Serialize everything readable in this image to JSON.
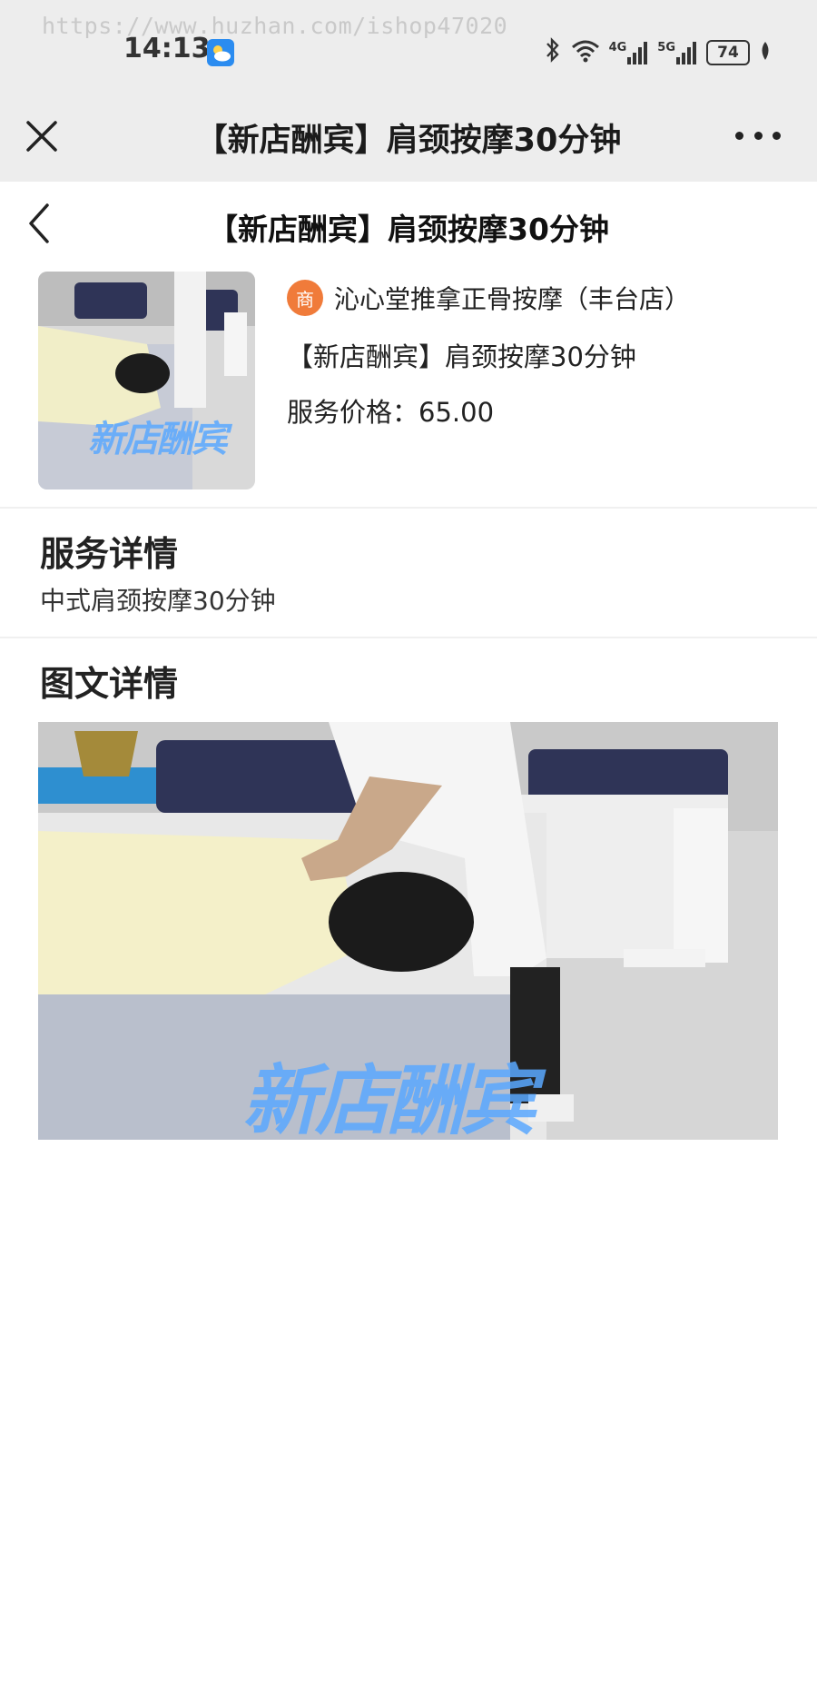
{
  "status_bar": {
    "watermark": "https://www.huzhan.com/ishop47020",
    "time": "14:13",
    "network_1": "4G",
    "network_2": "5G",
    "battery": "74"
  },
  "title_bar": {
    "title": "【新店酬宾】肩颈按摩30分钟"
  },
  "page_header": {
    "title": "【新店酬宾】肩颈按摩30分钟"
  },
  "product": {
    "merchant_badge": "商",
    "merchant_name": "沁心堂推拿正骨按摩（丰台店）",
    "name": "【新店酬宾】肩颈按摩30分钟",
    "price_label": "服务价格：",
    "price_value": "65.00",
    "image_caption": "新店酬宾"
  },
  "service_details": {
    "heading": "服务详情",
    "text": "中式肩颈按摩30分钟"
  },
  "graphic_details": {
    "heading": "图文详情",
    "image_caption": "新店酬宾"
  },
  "colors": {
    "bar_bg": "#ededed",
    "merchant_badge": "#f07b3a",
    "caption_blue": "#5aa8ff"
  }
}
